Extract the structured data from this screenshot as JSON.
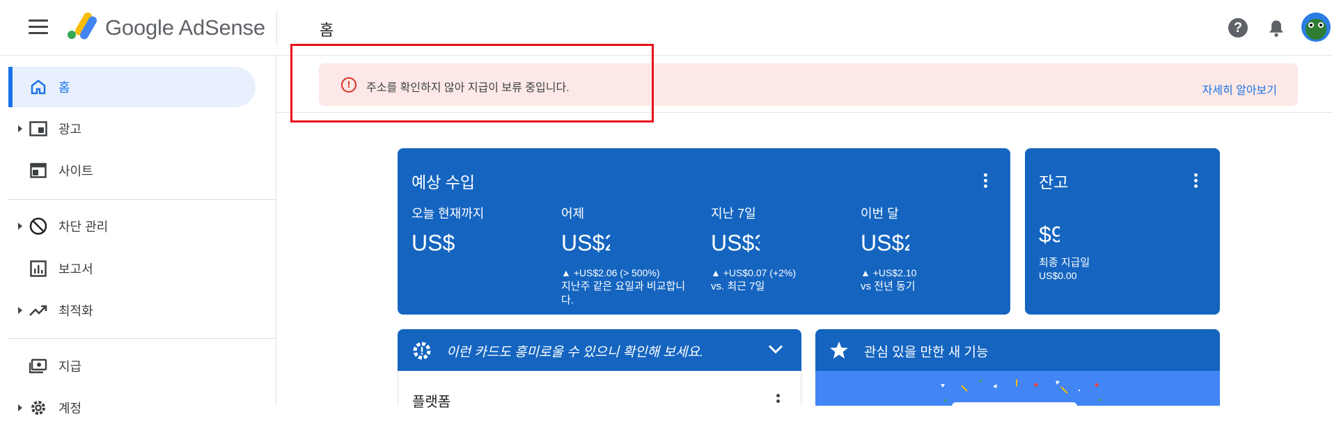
{
  "header": {
    "product_name": "Google AdSense",
    "page_title": "홈"
  },
  "sidebar": {
    "items": [
      {
        "label": "홈"
      },
      {
        "label": "광고"
      },
      {
        "label": "사이트"
      },
      {
        "label": "차단 관리"
      },
      {
        "label": "보고서"
      },
      {
        "label": "최적화"
      },
      {
        "label": "지급"
      },
      {
        "label": "계정"
      }
    ]
  },
  "alert": {
    "message": "주소를 확인하지 않아 지급이 보류 중입니다.",
    "link": "자세히 알아보기"
  },
  "earnings_card": {
    "title": "예상 수입",
    "metrics": [
      {
        "label": "오늘 현재까지",
        "value": "US$",
        "delta": "",
        "note": ""
      },
      {
        "label": "어제",
        "value": "US$2",
        "delta": "▲ +US$2.06 (> 500%)",
        "note": "지난주 같은 요일과 비교합니다."
      },
      {
        "label": "지난 7일",
        "value": "US$3",
        "delta": "▲ +US$0.07 (+2%)",
        "note": "vs. 최근 7일"
      },
      {
        "label": "이번 달",
        "value": "US$2",
        "delta": "▲ +US$2.10",
        "note": "vs 전년 동기"
      }
    ]
  },
  "balance_card": {
    "title": "잔고",
    "value": "$9",
    "last_payment_label": "최종 지급일",
    "last_payment_value": "US$0.00"
  },
  "suggestion_card": {
    "title": "이런 카드도 흥미로울 수 있으니 확인해 보세요.",
    "subtitle": "플랫폼"
  },
  "features_card": {
    "title": "관심 있을 만한 새 기능"
  },
  "colors": {
    "card_blue": "#1565c0",
    "alert_bg": "#fce8e6",
    "accent": "#1a73e8",
    "highlight_box": "#e8121a"
  }
}
